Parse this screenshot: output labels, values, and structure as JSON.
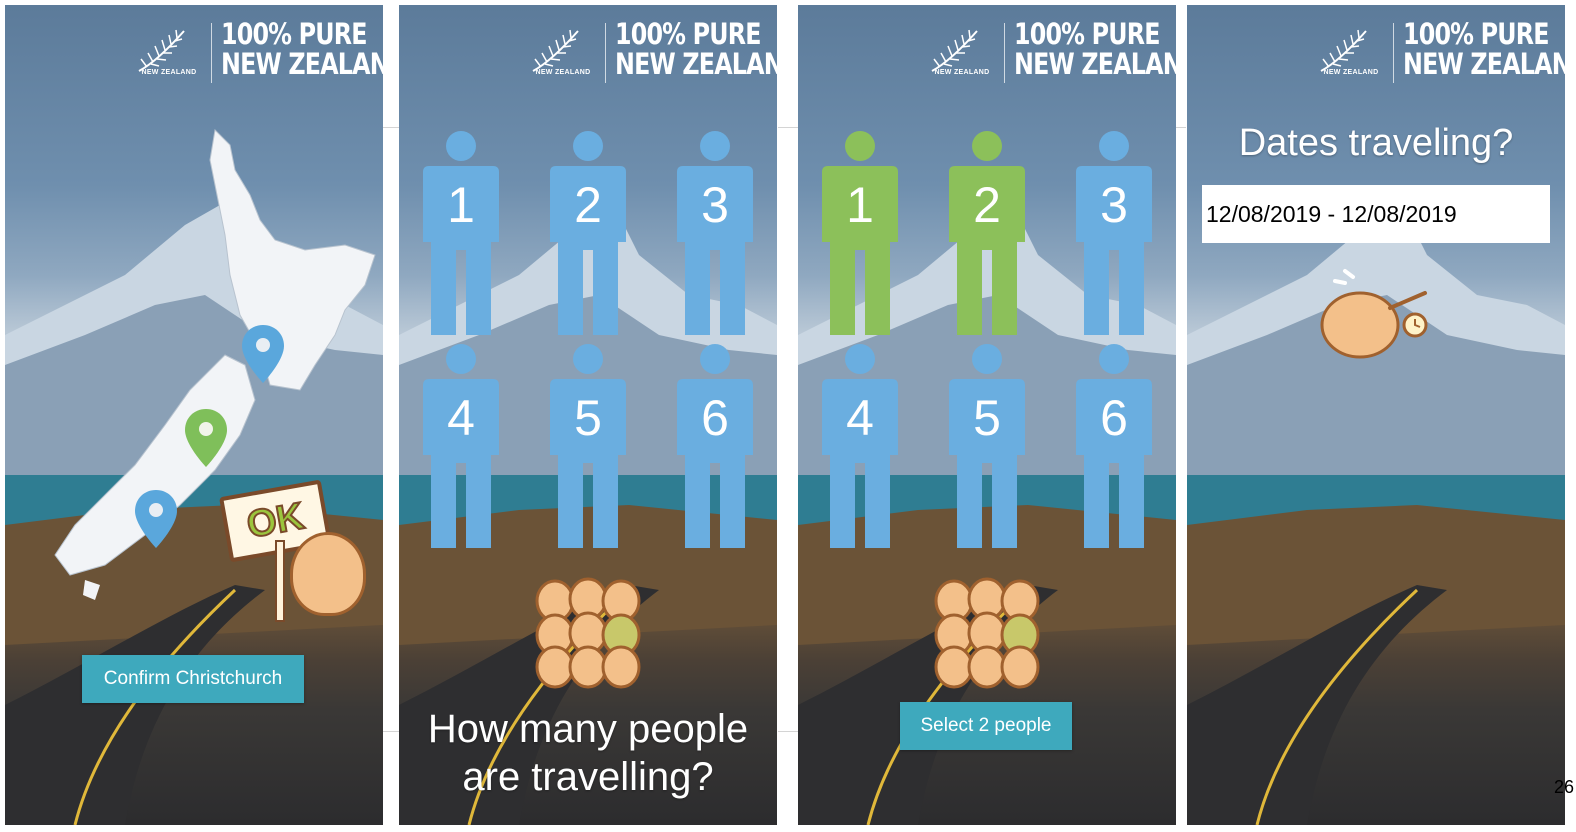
{
  "brand": {
    "title_line1": "100% PURE",
    "title_line2": "NEW ZEALAND",
    "logo_caption": "NEW ZEALAND"
  },
  "panels": [
    {
      "button_label": "Confirm Christchurch",
      "sign_text": "OK"
    },
    {
      "people": [
        "1",
        "2",
        "3",
        "4",
        "5",
        "6"
      ],
      "question_line1": "How many people",
      "question_line2": "are travelling?"
    },
    {
      "people": [
        "1",
        "2",
        "3",
        "4",
        "5",
        "6"
      ],
      "selected_count": 2,
      "button_label": "Select 2 people"
    },
    {
      "question": "Dates traveling?",
      "date_value": "12/08/2019 - 12/08/2019"
    }
  ],
  "page_number": "26",
  "colors": {
    "person_default": "#6aaee0",
    "person_selected": "#8cc05a",
    "button": "#3ea9bd",
    "pin_blue": "#5aa7dc",
    "pin_green": "#7fbf5a"
  }
}
